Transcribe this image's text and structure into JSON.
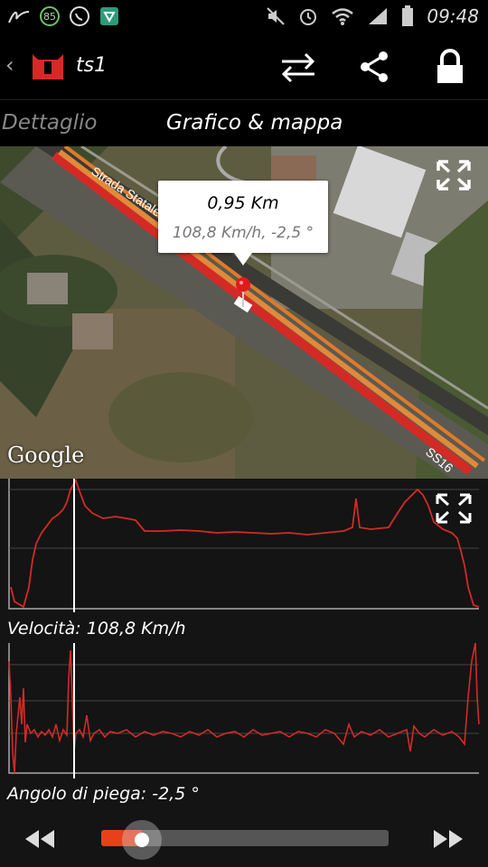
{
  "status_bar": {
    "battery_level": "85",
    "time": "09:48",
    "icons": [
      "signature-icon",
      "whatsapp-icon",
      "vpn-shield-icon",
      "mute-icon",
      "alarm-icon",
      "wifi-icon",
      "signal-icon",
      "battery-icon"
    ]
  },
  "app_bar": {
    "title": "ts1",
    "icons": [
      "back-chevron-icon",
      "app-logo-icon",
      "swap-arrows-icon",
      "share-icon",
      "lock-icon"
    ]
  },
  "tabs": [
    {
      "label": "Dettaglio",
      "selected": false
    },
    {
      "label": "Grafico & mappa",
      "selected": true
    }
  ],
  "map": {
    "attribution": "Google",
    "road_label": "Strada Statale",
    "road_code": "SS16",
    "tooltip": {
      "distance": "0,95 Km",
      "details": "108,8 Km/h, -2,5 °"
    }
  },
  "speed_chart": {
    "label": "Velocità: 108,8 Km/h"
  },
  "lean_chart": {
    "label": "Angolo di piega: -2,5 °"
  },
  "playback": {
    "progress": 0.14
  },
  "colors": {
    "line": "#d42a26",
    "background": "#141414",
    "accent": "#e8401c",
    "marker": "#ffffff"
  }
}
